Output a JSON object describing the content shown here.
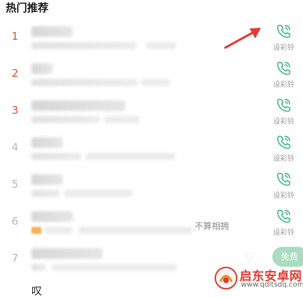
{
  "section": {
    "title": "热门推荐"
  },
  "ring_action_label": "设彩铃",
  "accent_color": "#3dba7f",
  "rank_hot_color": "#e0533f",
  "rows": [
    {
      "rank": "1",
      "hot": true
    },
    {
      "rank": "2",
      "hot": true
    },
    {
      "rank": "3",
      "hot": true
    },
    {
      "rank": "4",
      "hot": false
    },
    {
      "rank": "5",
      "hot": false
    },
    {
      "rank": "6",
      "hot": false,
      "tail": "不算相拥"
    },
    {
      "rank": "7",
      "hot": false,
      "action": "免费"
    }
  ],
  "partial_row": {
    "text": "叹"
  },
  "watermark": {
    "name": "启东安卓网",
    "url": "www.qdltsdq.com"
  },
  "icons": {
    "ring": "phone-ring-icon",
    "heart": "heart-icon",
    "arrow": "red-arrow-pointer",
    "logo": "watermark-logo-icon"
  }
}
